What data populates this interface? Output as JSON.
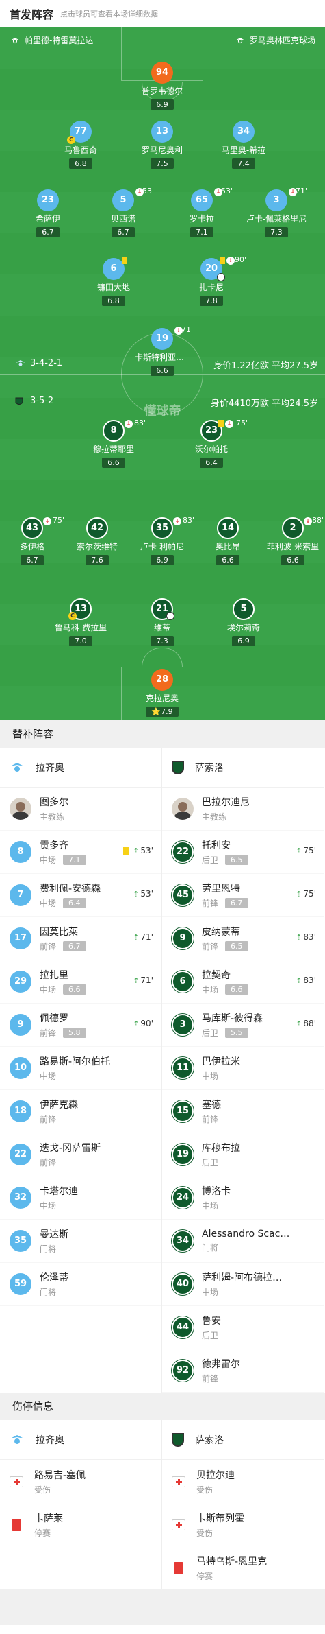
{
  "header": {
    "title": "首发阵容",
    "subtitle": "点击球员可查看本场详细数据"
  },
  "pitch": {
    "stadium_left": "帕里德-特雷莫拉达",
    "stadium_right": "罗马奥林匹克球场",
    "watermark": "懂球帝",
    "home_formation": "3-4-2-1",
    "home_info": "身价1.22亿欧  平均27.5岁",
    "away_formation": "3-5-2",
    "away_info": "身价4410万欧  平均24.5岁"
  },
  "home_players": [
    {
      "num": "94",
      "name": "普罗韦德尔",
      "rating": "6.9",
      "color": "orange"
    },
    {
      "num": "77",
      "name": "马鲁西奇",
      "rating": "6.8",
      "color": "blue",
      "captain": "C"
    },
    {
      "num": "13",
      "name": "罗马尼奥利",
      "rating": "7.5",
      "color": "blue"
    },
    {
      "num": "34",
      "name": "马里奥-希拉",
      "rating": "7.4",
      "color": "blue"
    },
    {
      "num": "23",
      "name": "希萨伊",
      "rating": "6.7",
      "color": "blue"
    },
    {
      "num": "5",
      "name": "贝西诺",
      "rating": "6.7",
      "color": "blue",
      "sub_min": "53'"
    },
    {
      "num": "65",
      "name": "罗卡拉",
      "rating": "7.1",
      "color": "blue",
      "sub_min": "53'"
    },
    {
      "num": "3",
      "name": "卢卡-佩莱格里尼",
      "rating": "7.3",
      "color": "blue",
      "sub_min": "71'"
    },
    {
      "num": "6",
      "name": "镰田大地",
      "rating": "6.8",
      "color": "blue"
    },
    {
      "num": "20",
      "name": "扎卡尼",
      "rating": "7.8",
      "color": "blue",
      "sub_min": "90'"
    },
    {
      "num": "19",
      "name": "卡斯特利亚诺斯",
      "rating": "6.6",
      "color": "blue",
      "sub_min": "71'"
    }
  ],
  "away_players": [
    {
      "num": "8",
      "name": "穆拉蒂耶里",
      "rating": "6.6",
      "sub_min": "83'"
    },
    {
      "num": "23",
      "name": "沃尔帕托",
      "rating": "6.4",
      "sub_min": "75'"
    },
    {
      "num": "43",
      "name": "多伊格",
      "rating": "6.7",
      "sub_min": "75'"
    },
    {
      "num": "42",
      "name": "索尔茨维特",
      "rating": "7.6"
    },
    {
      "num": "35",
      "name": "卢卡-利帕尼",
      "rating": "6.9",
      "sub_min": "83'"
    },
    {
      "num": "14",
      "name": "奥比昂",
      "rating": "6.6"
    },
    {
      "num": "2",
      "name": "菲利波-米索里",
      "rating": "6.6",
      "sub_min": "88'"
    },
    {
      "num": "13",
      "name": "鲁马科-费拉里",
      "rating": "7.0",
      "captain": "C"
    },
    {
      "num": "21",
      "name": "维蒂",
      "rating": "7.3"
    },
    {
      "num": "5",
      "name": "埃尔莉奇",
      "rating": "6.9"
    },
    {
      "num": "28",
      "name": "克拉尼奥",
      "rating": "7.9",
      "color": "orange"
    }
  ],
  "subs": {
    "title": "替补阵容",
    "home_team": "拉齐奥",
    "away_team": "萨索洛",
    "coach_label": "主教练",
    "home_coach": "图多尔",
    "away_coach": "巴拉尔迪尼",
    "home": [
      {
        "num": "8",
        "name": "贡多齐",
        "pos": "中场",
        "rating": "7.1",
        "min": "53'",
        "yellow": true
      },
      {
        "num": "7",
        "name": "费利佩-安德森",
        "pos": "中场",
        "rating": "6.4",
        "min": "53'"
      },
      {
        "num": "17",
        "name": "因莫比莱",
        "pos": "前锋",
        "rating": "6.7",
        "min": "71'"
      },
      {
        "num": "29",
        "name": "拉扎里",
        "pos": "中场",
        "rating": "6.6",
        "min": "71'"
      },
      {
        "num": "9",
        "name": "佩德罗",
        "pos": "前锋",
        "rating": "5.8",
        "min": "90'"
      },
      {
        "num": "10",
        "name": "路易斯-阿尔伯托",
        "pos": "中场"
      },
      {
        "num": "18",
        "name": "伊萨克森",
        "pos": "前锋"
      },
      {
        "num": "22",
        "name": "迭戈-冈萨雷斯",
        "pos": "前锋"
      },
      {
        "num": "32",
        "name": "卡塔尔迪",
        "pos": "中场"
      },
      {
        "num": "35",
        "name": "曼达斯",
        "pos": "门将"
      },
      {
        "num": "59",
        "name": "伦泽蒂",
        "pos": "门将"
      }
    ],
    "away": [
      {
        "num": "22",
        "name": "托利安",
        "pos": "后卫",
        "rating": "6.5",
        "min": "75'"
      },
      {
        "num": "45",
        "name": "劳里恩特",
        "pos": "前锋",
        "rating": "6.7",
        "min": "75'"
      },
      {
        "num": "9",
        "name": "皮纳蒙蒂",
        "pos": "前锋",
        "rating": "6.5",
        "min": "83'"
      },
      {
        "num": "6",
        "name": "拉契奇",
        "pos": "中场",
        "rating": "6.6",
        "min": "83'"
      },
      {
        "num": "3",
        "name": "马库斯-彼得森",
        "pos": "后卫",
        "rating": "5.5",
        "min": "88'"
      },
      {
        "num": "11",
        "name": "巴伊拉米",
        "pos": "中场"
      },
      {
        "num": "15",
        "name": "塞德",
        "pos": "前锋"
      },
      {
        "num": "19",
        "name": "库穆布拉",
        "pos": "后卫"
      },
      {
        "num": "24",
        "name": "博洛卡",
        "pos": "中场"
      },
      {
        "num": "34",
        "name": "Alessandro Scacchetti",
        "pos": "门将"
      },
      {
        "num": "40",
        "name": "萨利姆-阿布德拉赫曼",
        "pos": "中场"
      },
      {
        "num": "44",
        "name": "鲁安",
        "pos": "后卫"
      },
      {
        "num": "92",
        "name": "德弗雷尔",
        "pos": "前锋"
      }
    ]
  },
  "injuries": {
    "title": "伤停信息",
    "home_team": "拉齐奥",
    "away_team": "萨索洛",
    "home": [
      {
        "name": "路易吉-塞佩",
        "status": "受伤",
        "type": "injury"
      },
      {
        "name": "卡萨莱",
        "status": "停赛",
        "type": "card"
      }
    ],
    "away": [
      {
        "name": "贝拉尔迪",
        "status": "受伤",
        "type": "injury"
      },
      {
        "name": "卡斯蒂列霍",
        "status": "受伤",
        "type": "injury"
      },
      {
        "name": "马特乌斯-恩里克",
        "status": "停赛",
        "type": "card"
      }
    ]
  },
  "colors": {
    "pitch": "#3aa34a",
    "home": "#5cb8ec",
    "away": "#0f5a2c",
    "gk": "#f26b1d"
  }
}
